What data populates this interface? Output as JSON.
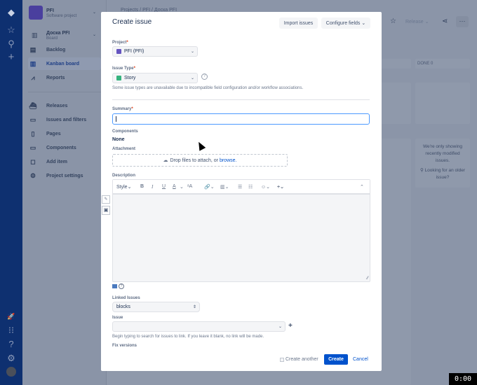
{
  "global_nav": {
    "icons": [
      "jira-logo-icon",
      "star-icon",
      "search-icon",
      "plus-icon",
      "notification-icon",
      "apps-grid-icon",
      "help-icon",
      "settings-icon",
      "user-avatar"
    ]
  },
  "sidebar": {
    "project_name": "PFI",
    "project_type": "Software project",
    "board_name": "Доска PFI",
    "board_type": "Board",
    "items": [
      {
        "label": "Backlog",
        "icon": "backlog-icon"
      },
      {
        "label": "Kanban board",
        "icon": "board-icon",
        "active": true
      },
      {
        "label": "Reports",
        "icon": "reports-icon"
      },
      {
        "label": "Releases",
        "icon": "ship-icon"
      },
      {
        "label": "Issues and filters",
        "icon": "issues-icon"
      },
      {
        "label": "Pages",
        "icon": "page-icon"
      },
      {
        "label": "Components",
        "icon": "components-icon"
      },
      {
        "label": "Add item",
        "icon": "add-item-icon"
      },
      {
        "label": "Project settings",
        "icon": "gear-icon"
      }
    ]
  },
  "main": {
    "breadcrumb": [
      "Projects",
      "PFI",
      "Доска PFI"
    ],
    "release_label": "Release",
    "done_column": "DONE 0",
    "notice": "We're only showing recently modified issues.",
    "older_link": "Looking for an older issue?"
  },
  "modal": {
    "title": "Create issue",
    "import_label": "Import issues",
    "configure_label": "Configure fields",
    "project_label": "Project",
    "project_value": "PFI (PFI)",
    "issue_type_label": "Issue Type",
    "issue_type_value": "Story",
    "issue_type_note": "Some issue types are unavailable due to incompatible field configuration and/or workflow associations.",
    "summary_label": "Summary",
    "summary_value": "",
    "components_label": "Components",
    "components_value": "None",
    "attachment_label": "Attachment",
    "drop_text": "Drop files to attach, or",
    "browse_text": "browse.",
    "description_label": "Description",
    "toolbar": {
      "style": "Style",
      "bold": "B",
      "italic": "I",
      "underline": "U",
      "color": "A",
      "more_format": "ᵃA"
    },
    "linked_issues_label": "Linked Issues",
    "linked_issues_value": "blocks",
    "issue_label": "Issue",
    "issue_value": "",
    "issue_hint": "Begin typing to search for issues to link. If you leave it blank, no link will be made.",
    "fix_versions_label": "Fix versions",
    "create_another_label": "Create another",
    "create_label": "Create",
    "cancel_label": "Cancel",
    "accent": "#0052cc"
  },
  "recording_timer": "0:00"
}
